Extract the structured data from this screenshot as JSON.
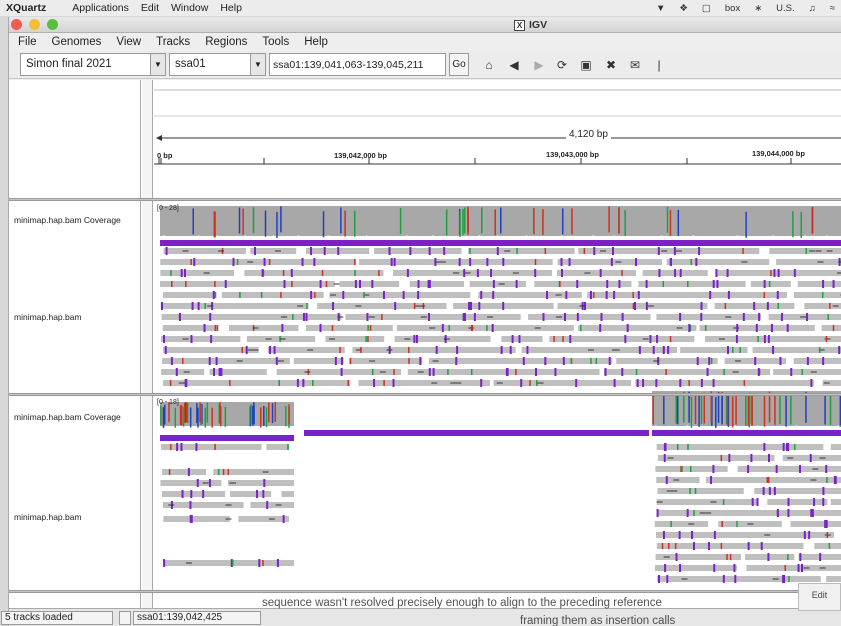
{
  "menubar": {
    "app": "XQuartz",
    "items": [
      "Applications",
      "Edit",
      "Window",
      "Help"
    ],
    "right": {
      "brand": "box",
      "locale": "U.S."
    }
  },
  "window": {
    "title": "IGV"
  },
  "menu": [
    "File",
    "Genomes",
    "View",
    "Tracks",
    "Regions",
    "Tools",
    "Help"
  ],
  "toolbar": {
    "genome": "Simon final 2021",
    "chromosome": "ssa01",
    "locus": "ssa01:139,041,063-139,045,211",
    "go_label": "Go"
  },
  "ruler": {
    "span": "4,120 bp",
    "ticks": [
      "0 bp",
      "139,042,000 bp",
      "139,043,000 bp",
      "139,044,000 bp"
    ]
  },
  "panels": [
    {
      "coverage_name": "minimap.hap.bam Coverage",
      "range": "[0 - 28]",
      "alignment_name": "minimap.hap.bam"
    },
    {
      "coverage_name": "minimap.hap.bam Coverage",
      "range": "[0 - 18]",
      "alignment_name": "minimap.hap.bam"
    }
  ],
  "status": {
    "tracks_loaded": "5 tracks loaded",
    "position": "ssa01:139,042,425"
  },
  "background_text": {
    "line1": "sequence wasn't resolved precisely enough to align to the preceding reference",
    "line2": "framing them as insertion calls"
  },
  "edit_label": "Edit",
  "colors": {
    "insertion": "#7a22c8",
    "read": "#bfbfbf",
    "coverage": "#a8a8a8",
    "mismatch_red": "#d03020",
    "mismatch_blue": "#2040c0",
    "mismatch_green": "#20a040"
  }
}
